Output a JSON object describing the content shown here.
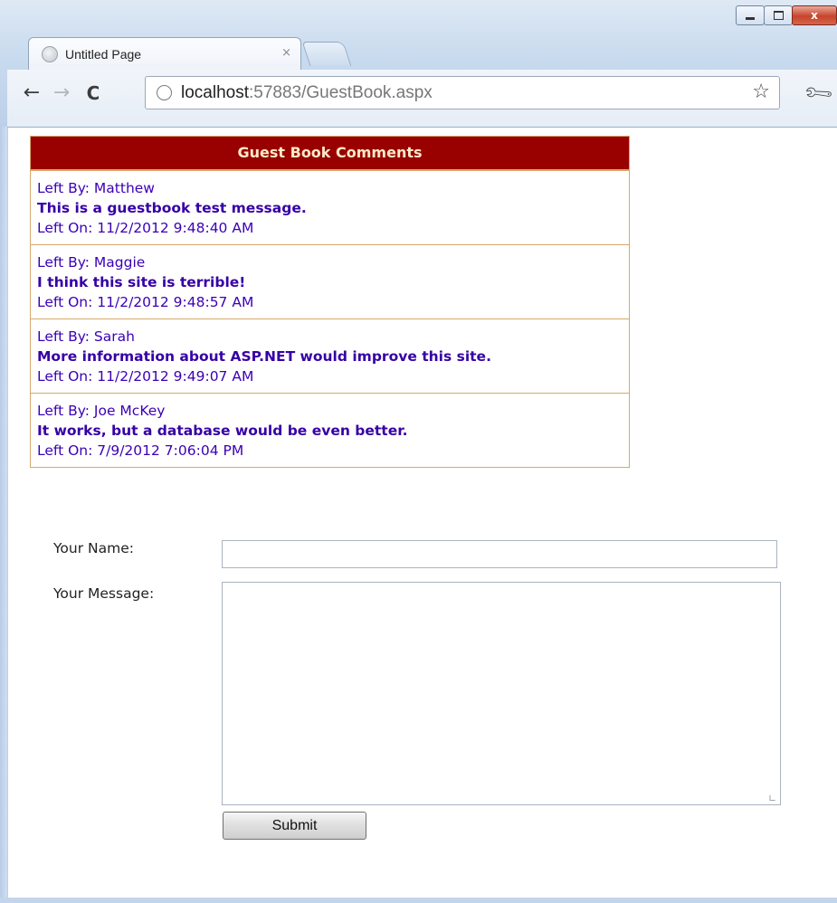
{
  "browser": {
    "tab_title": "Untitled Page",
    "tab_close": "×",
    "url_host": "localhost",
    "url_rest": ":57883/GuestBook.aspx",
    "window_close": "x"
  },
  "guestbook": {
    "header": "Guest Book Comments",
    "entries": [
      {
        "by": "Left By: Matthew",
        "message": "This is a guestbook test message.",
        "on": "Left On: 11/2/2012 9:48:40 AM"
      },
      {
        "by": "Left By: Maggie",
        "message": "I think this site is terrible!",
        "on": "Left On: 11/2/2012 9:48:57 AM"
      },
      {
        "by": "Left By: Sarah",
        "message": "More information about ASP.NET would improve this site.",
        "on": "Left On: 11/2/2012 9:49:07 AM"
      },
      {
        "by": "Left By: Joe McKey",
        "message": "It works, but a database would be even better.",
        "on": "Left On: 7/9/2012 7:06:04 PM"
      }
    ]
  },
  "form": {
    "name_label": "Your Name:",
    "name_value": "",
    "message_label": "Your Message:",
    "message_value": "",
    "submit_label": "Submit"
  },
  "colors": {
    "header_bg": "#990000",
    "header_text": "#ffe9c9",
    "entry_text": "#3b00b5",
    "border": "#d6a86b"
  }
}
